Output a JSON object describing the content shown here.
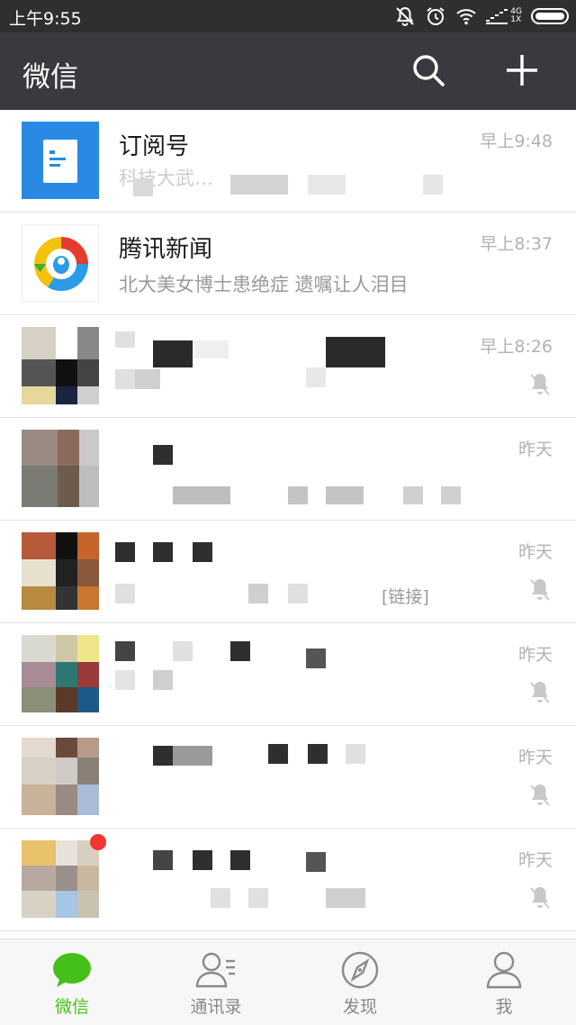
{
  "status_bar": {
    "time": "上午9:55",
    "network_type": "4G",
    "network_sub": "1X"
  },
  "header": {
    "title": "微信"
  },
  "chats": [
    {
      "name": "订阅号",
      "preview": "科技大武…",
      "time": "早上9:48",
      "muted": false
    },
    {
      "name": "腾讯新闻",
      "preview": "北大美女博士患绝症 遗嘱让人泪目",
      "time": "早上8:37",
      "muted": false
    },
    {
      "name": "",
      "preview": "",
      "time": "早上8:26",
      "muted": true
    },
    {
      "name": "",
      "preview": "",
      "time": "昨天",
      "muted": false
    },
    {
      "name": "",
      "preview": "[链接]",
      "time": "昨天",
      "muted": true
    },
    {
      "name": "",
      "preview": "",
      "time": "昨天",
      "muted": true
    },
    {
      "name": "",
      "preview": "",
      "time": "昨天",
      "muted": true
    },
    {
      "name": "",
      "preview": "",
      "time": "昨天",
      "muted": true
    }
  ],
  "tabs": [
    {
      "label": "微信",
      "icon": "chat-bubble-icon",
      "active": true
    },
    {
      "label": "通讯录",
      "icon": "contacts-icon",
      "active": false
    },
    {
      "label": "发现",
      "icon": "compass-icon",
      "active": false
    },
    {
      "label": "我",
      "icon": "person-icon",
      "active": false
    }
  ],
  "colors": {
    "header_bg": "#393a3f",
    "status_bg": "#2e2f30",
    "accent_green": "#45c01a",
    "badge_red": "#f43530",
    "subscription_blue": "#2a8ae3"
  }
}
